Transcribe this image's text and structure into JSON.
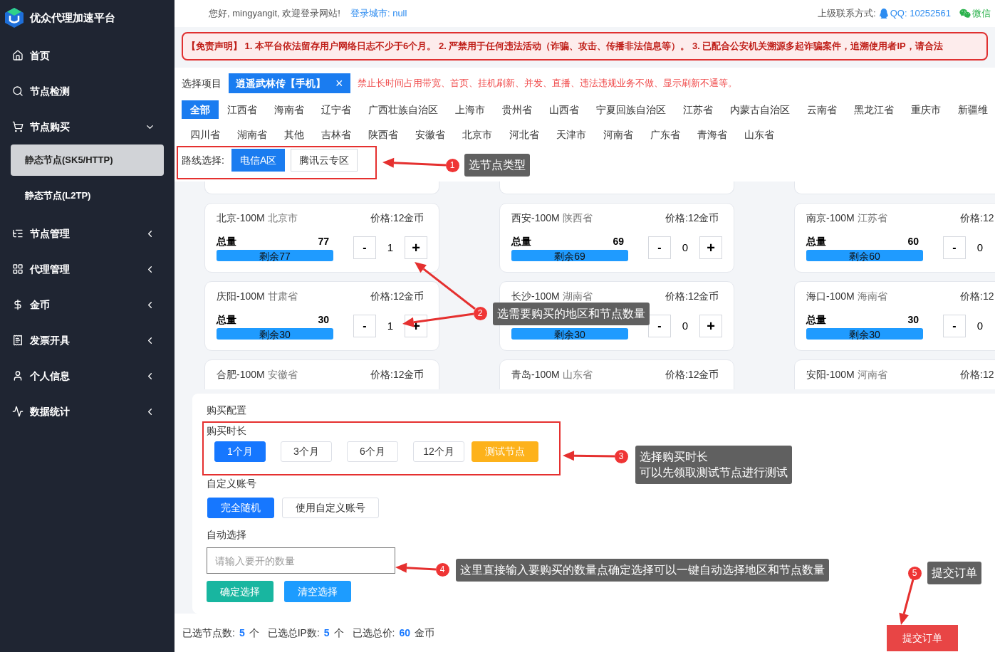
{
  "sidebar": {
    "brand": "优众代理加速平台",
    "items": [
      {
        "label": "首页"
      },
      {
        "label": "节点检测"
      },
      {
        "label": "节点购买",
        "expanded": true,
        "children": [
          {
            "label": "静态节点(SK5/HTTP)",
            "selected": true
          },
          {
            "label": "静态节点(L2TP)",
            "selected": false
          }
        ]
      },
      {
        "label": "节点管理",
        "expanded": false
      },
      {
        "label": "代理管理",
        "expanded": false
      },
      {
        "label": "金币",
        "expanded": false
      },
      {
        "label": "发票开具",
        "expanded": false
      },
      {
        "label": "个人信息",
        "expanded": false
      },
      {
        "label": "数据统计",
        "expanded": false
      }
    ]
  },
  "topbar": {
    "greeting": "您好, mingyangit, 欢迎登录网站!",
    "city": "登录城市: null",
    "contact_label": "上级联系方式:",
    "qq": "QQ: 10252561",
    "wechat": "微信"
  },
  "disclaimer": "【免责声明】 1. 本平台依法留存用户网络日志不少于6个月。 2. 严禁用于任何违法活动（诈骗、攻击、传播非法信息等）。 3. 已配合公安机关溯源多起诈骗案件，追溯使用者IP，请合法",
  "project": {
    "label": "选择项目",
    "tag": "逍遥武林传【手机】",
    "close": "×",
    "notice": "禁止长时间占用带宽、首页、挂机刷新、并发、直播、违法违规业务不做、显示刷新不通等。"
  },
  "region_rows": [
    [
      {
        "label": "全部",
        "selected": true
      },
      {
        "label": "江西省",
        "selected": false
      },
      {
        "label": "海南省",
        "selected": false
      },
      {
        "label": "辽宁省",
        "selected": false
      },
      {
        "label": "广西壮族自治区",
        "selected": false
      },
      {
        "label": "上海市",
        "selected": false
      },
      {
        "label": "贵州省",
        "selected": false
      },
      {
        "label": "山西省",
        "selected": false
      },
      {
        "label": "宁夏回族自治区",
        "selected": false
      },
      {
        "label": "江苏省",
        "selected": false
      },
      {
        "label": "内蒙古自治区",
        "selected": false
      },
      {
        "label": "云南省",
        "selected": false
      },
      {
        "label": "黑龙江省",
        "selected": false
      },
      {
        "label": "重庆市",
        "selected": false
      },
      {
        "label": "新疆维",
        "selected": false
      }
    ],
    [
      {
        "label": "四川省",
        "selected": false
      },
      {
        "label": "湖南省",
        "selected": false
      },
      {
        "label": "其他",
        "selected": false
      },
      {
        "label": "吉林省",
        "selected": false
      },
      {
        "label": "陕西省",
        "selected": false
      },
      {
        "label": "安徽省",
        "selected": false
      },
      {
        "label": "北京市",
        "selected": false
      },
      {
        "label": "河北省",
        "selected": false
      },
      {
        "label": "天津市",
        "selected": false
      },
      {
        "label": "河南省",
        "selected": false
      },
      {
        "label": "广东省",
        "selected": false
      },
      {
        "label": "青海省",
        "selected": false
      },
      {
        "label": "山东省",
        "selected": false
      }
    ]
  ],
  "route": {
    "label": "路线选择:",
    "options": [
      {
        "label": "电信A区",
        "selected": true
      },
      {
        "label": "腾讯云专区",
        "selected": false
      }
    ]
  },
  "cards": [
    {
      "title": "北京-100M",
      "region": "北京市",
      "price": "价格:12金币",
      "total_label": "总量",
      "total": "77",
      "remaining": "剩余77",
      "level": 1,
      "minus": "-",
      "quantity": "1",
      "plus": "+"
    },
    {
      "title": "西安-100M",
      "region": "陕西省",
      "price": "价格:12金币",
      "total_label": "总量",
      "total": "69",
      "remaining": "剩余69",
      "level": 1,
      "minus": "-",
      "quantity": "0",
      "plus": "+"
    },
    {
      "title": "南京-100M",
      "region": "江苏省",
      "price": "价格:12",
      "total_label": "总量",
      "total": "60",
      "remaining": "剩余60",
      "level": 1,
      "minus": "-",
      "quantity": "0"
    },
    {
      "title": "庆阳-100M",
      "region": "甘肃省",
      "price": "价格:12金币",
      "total_label": "总量",
      "total": "30",
      "remaining": "剩余30",
      "level": 1,
      "minus": "-",
      "quantity": "1",
      "plus": "+"
    },
    {
      "title": "长沙-100M",
      "region": "湖南省",
      "price": "价格:12金币",
      "remaining": "剩余30",
      "level": 1,
      "minus": "-",
      "quantity": "0",
      "plus": "+"
    },
    {
      "title": "海口-100M",
      "region": "海南省",
      "price": "价格:12",
      "total_label": "总量",
      "total": "30",
      "remaining": "剩余30",
      "level": 1,
      "minus": "-",
      "quantity": "0"
    },
    {
      "title": "合肥-100M",
      "region": "安徽省",
      "price": "价格:12金币"
    },
    {
      "title": "青岛-100M",
      "region": "山东省",
      "price": "价格:12金币"
    },
    {
      "title": "安阳-100M",
      "region": "河南省",
      "price": "价格:12"
    }
  ],
  "config": {
    "title": "购买配置",
    "duration_label": "购买时长",
    "durations": [
      {
        "label": "1个月",
        "kind": "option",
        "selected": true
      },
      {
        "label": "3个月",
        "kind": "option",
        "selected": false
      },
      {
        "label": "6个月",
        "kind": "option",
        "selected": false
      },
      {
        "label": "12个月",
        "kind": "option",
        "selected": false
      },
      {
        "label": "测试节点",
        "kind": "test",
        "selected": false
      }
    ],
    "account_label": "自定义账号",
    "account_options": [
      {
        "label": "完全随机",
        "selected": true
      },
      {
        "label": "使用自定义账号",
        "selected": false
      }
    ],
    "auto_label": "自动选择",
    "auto_placeholder": "请输入要开的数量",
    "auto_buttons": [
      {
        "label": "确定选择",
        "kind": "confirm"
      },
      {
        "label": "清空选择",
        "kind": "clear"
      }
    ]
  },
  "summary": [
    {
      "label": "已选节点数:",
      "value": "5",
      "unit": "个"
    },
    {
      "label": "已选总IP数:",
      "value": "5",
      "unit": "个"
    },
    {
      "label": "已选总价:",
      "value": "60",
      "unit": "金币"
    }
  ],
  "submit": "提交订单",
  "annotations": [
    {
      "number": "1",
      "lines": [
        "选节点类型"
      ]
    },
    {
      "number": "2",
      "lines": [
        "选需要购买的地区和节点数量"
      ]
    },
    {
      "number": "3",
      "lines": [
        "选择购买时长",
        "可以先领取测试节点进行测试"
      ]
    },
    {
      "number": "4",
      "lines": [
        "这里直接输入要购买的数量点确定选择可以一键自动选择地区和节点数量"
      ]
    },
    {
      "number": "5",
      "lines": [
        "提交订单"
      ]
    }
  ]
}
